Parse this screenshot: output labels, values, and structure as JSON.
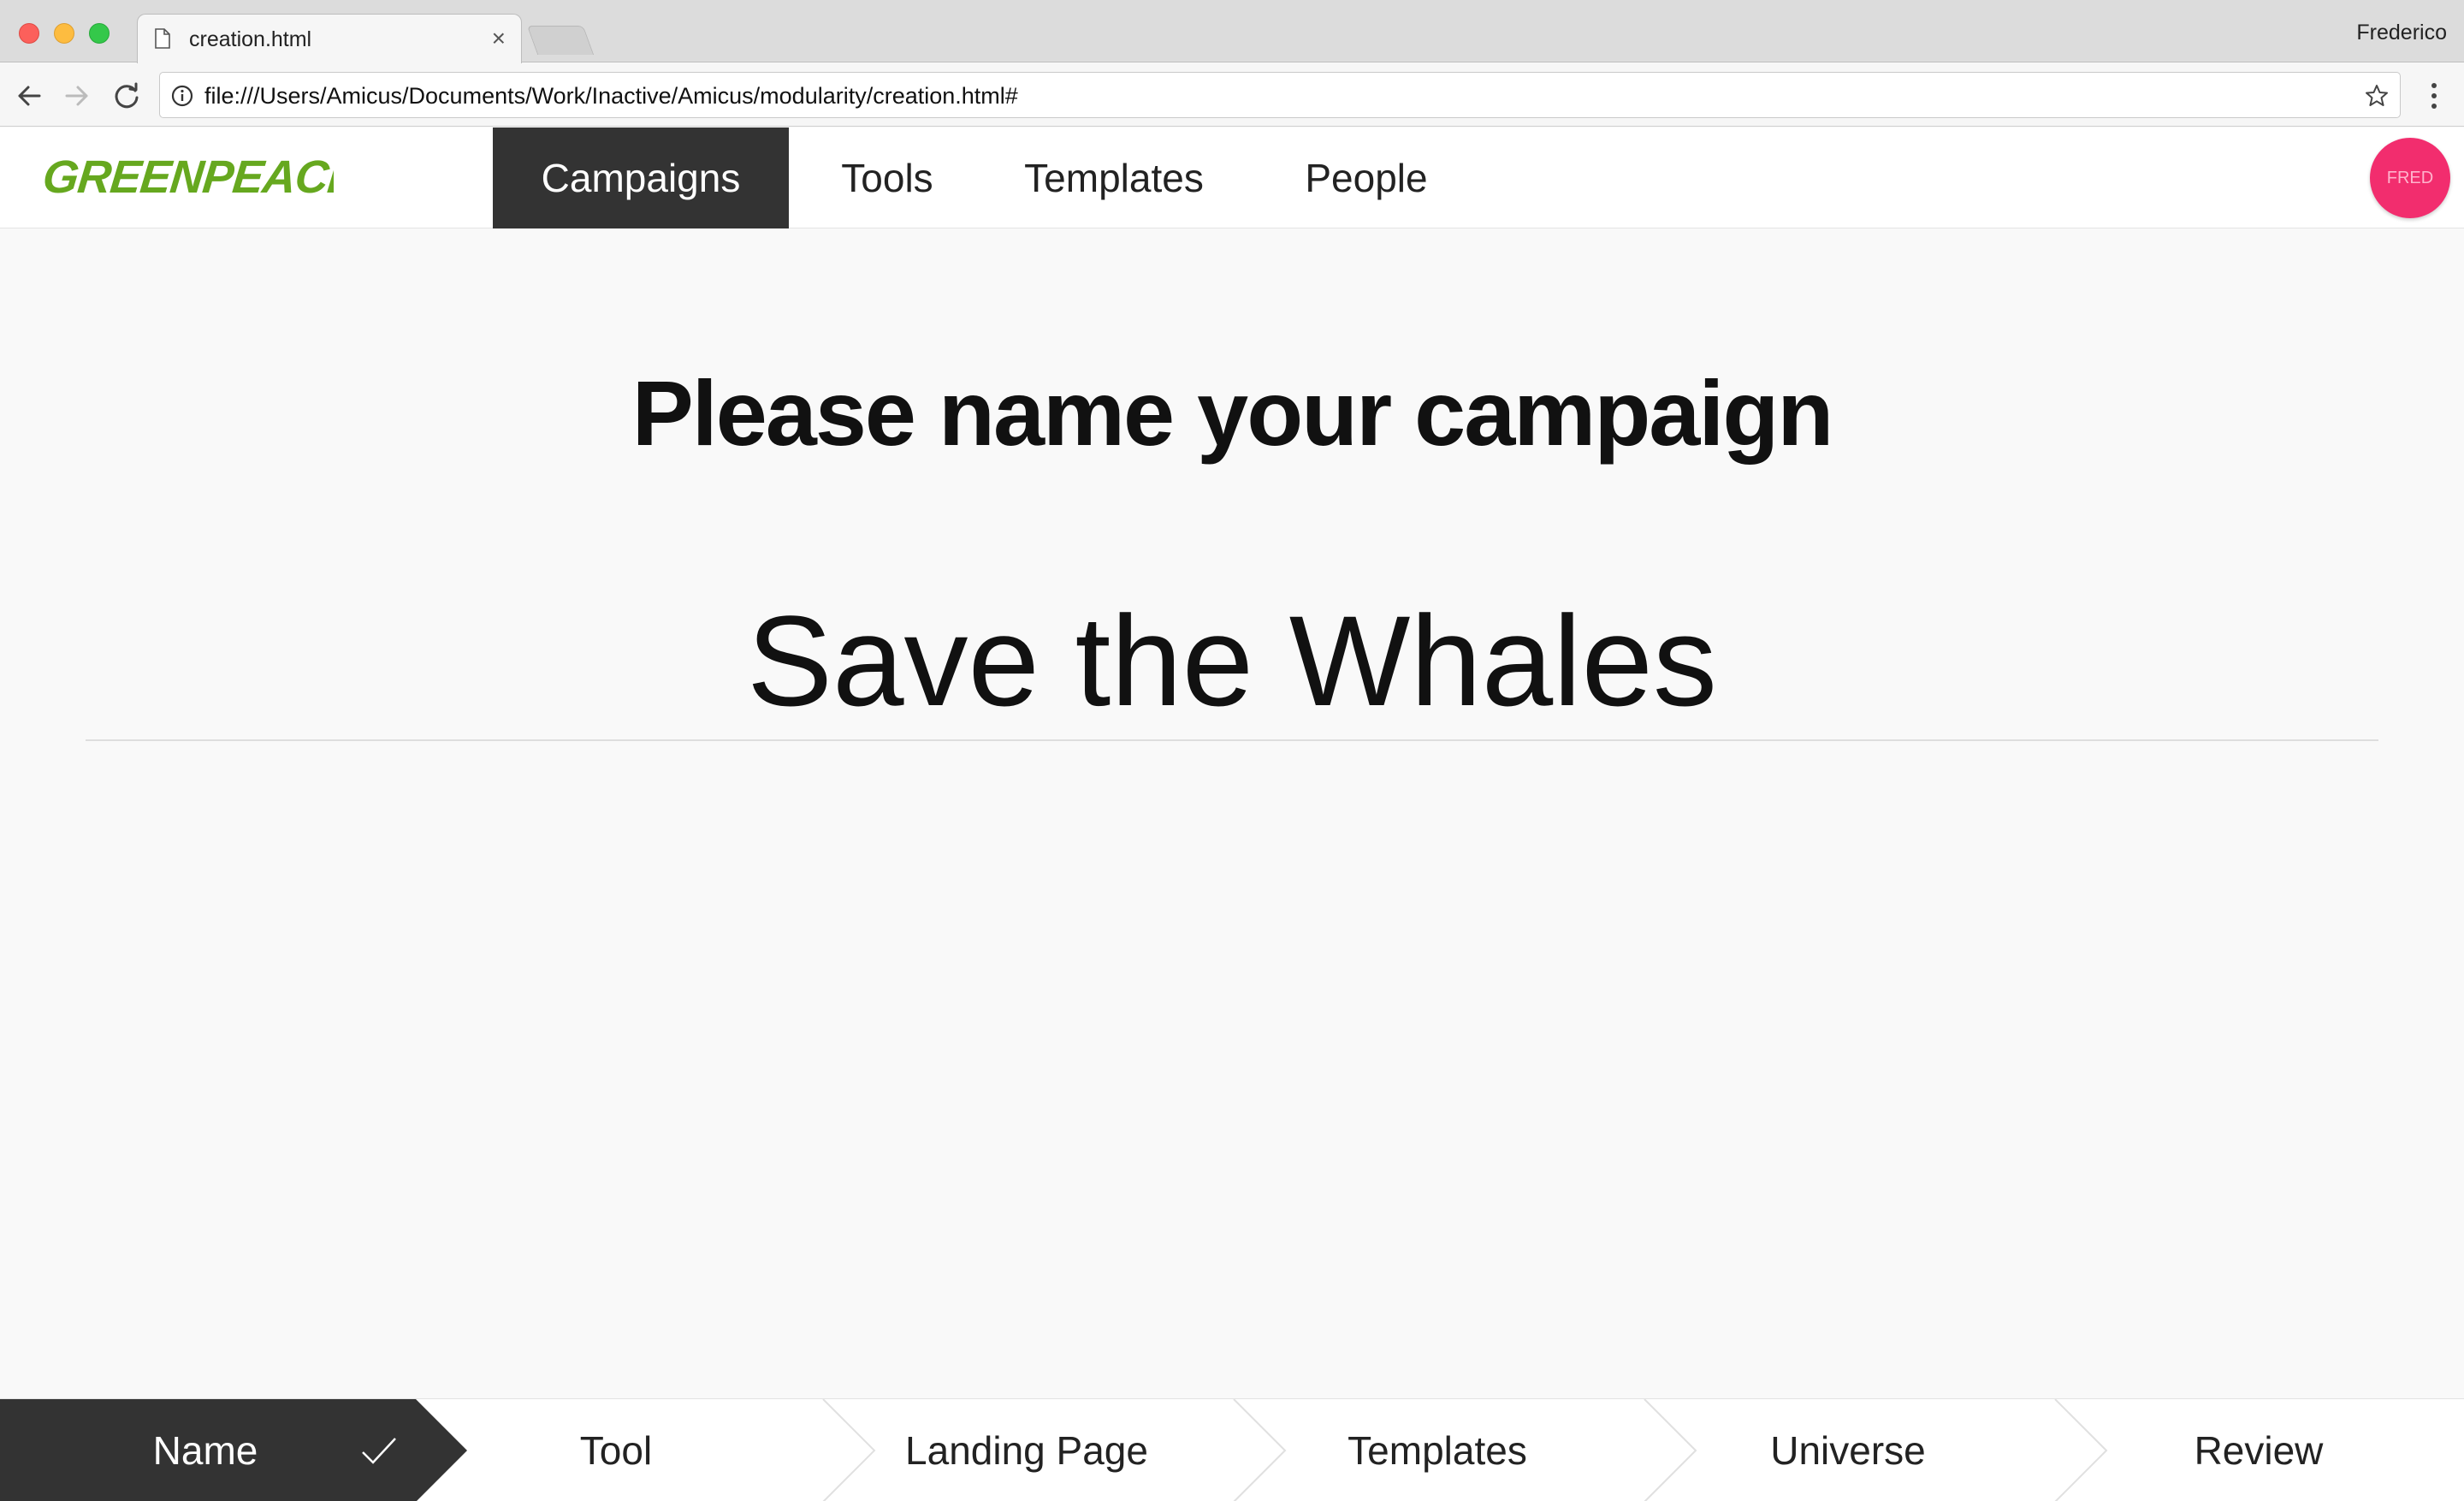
{
  "browser": {
    "tab_title": "creation.html",
    "tab_close": "×",
    "profile_name": "Frederico",
    "url": "file:///Users/Amicus/Documents/Work/Inactive/Amicus/modularity/creation.html#"
  },
  "header": {
    "logo_text": "GREENPEACE",
    "nav": [
      {
        "label": "Campaigns",
        "active": true
      },
      {
        "label": "Tools",
        "active": false
      },
      {
        "label": "Templates",
        "active": false
      },
      {
        "label": "People",
        "active": false
      }
    ],
    "avatar_initials": "FRED",
    "avatar_color": "#f22d6e"
  },
  "main": {
    "heading": "Please name your campaign",
    "campaign_name_value": "Save the Whales"
  },
  "steps": [
    {
      "label": "Name",
      "completed": true,
      "active": true
    },
    {
      "label": "Tool",
      "completed": false,
      "active": false
    },
    {
      "label": "Landing Page",
      "completed": false,
      "active": false
    },
    {
      "label": "Templates",
      "completed": false,
      "active": false
    },
    {
      "label": "Universe",
      "completed": false,
      "active": false
    },
    {
      "label": "Review",
      "completed": false,
      "active": false
    }
  ],
  "colors": {
    "brand_green": "#66a81f",
    "active_dark": "#333333",
    "background": "#f9f9f9"
  },
  "icons": {
    "back": "arrow-left-icon",
    "forward": "arrow-right-icon",
    "reload": "reload-icon",
    "info": "info-icon",
    "star": "star-icon",
    "menu": "vertical-dots-icon",
    "check": "check-icon",
    "doc": "document-icon"
  }
}
